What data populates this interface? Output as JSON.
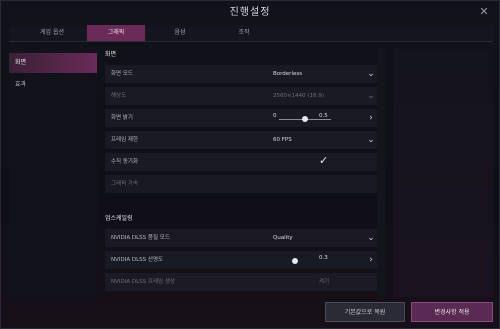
{
  "window": {
    "title": "진행설정",
    "close_glyph": "✕"
  },
  "tabs": [
    {
      "label": "게임 옵션",
      "active": false
    },
    {
      "label": "그래픽",
      "active": true
    },
    {
      "label": "음성",
      "active": false
    },
    {
      "label": "조작",
      "active": false
    }
  ],
  "sidebar": {
    "items": [
      {
        "label": "화면",
        "active": true
      },
      {
        "label": "효과",
        "active": false
      }
    ]
  },
  "sections": {
    "display_title": "화면",
    "upscale_title": "업스케일링"
  },
  "settings": {
    "display_mode": {
      "label": "화면 모드",
      "value": "Borderless"
    },
    "resolution": {
      "label": "해상도",
      "value": "2560×1440 (16:9)"
    },
    "brightness": {
      "label": "화면 밝기",
      "min_label": "0",
      "max_label": "0.5",
      "value": 0.5
    },
    "frame_limit": {
      "label": "프레임 제한",
      "value": "60 FPS"
    },
    "vsync": {
      "label": "수직 동기화",
      "checked": true
    },
    "extra": {
      "label": "그래픽 가속"
    },
    "dlss_mode": {
      "label": "NVIDIA DLSS 품질 모드",
      "value": "Quality"
    },
    "dlss_sharpness": {
      "label": "NVIDIA DLSS 선명도",
      "value": "0.3",
      "level": 0.3
    },
    "dlss_frame": {
      "label": "NVIDIA DLSS 프레임 생성",
      "value": "켜기"
    }
  },
  "buttons": {
    "reset": "기본값으로 복원",
    "apply": "변경사항 적용"
  },
  "icons": {
    "chevron_down": "chevron-down-icon",
    "chevron_right": "chevron-right-icon",
    "check": "check-icon"
  },
  "colors": {
    "accent": "#6a2b59",
    "button_primary": "#5a2a52"
  }
}
